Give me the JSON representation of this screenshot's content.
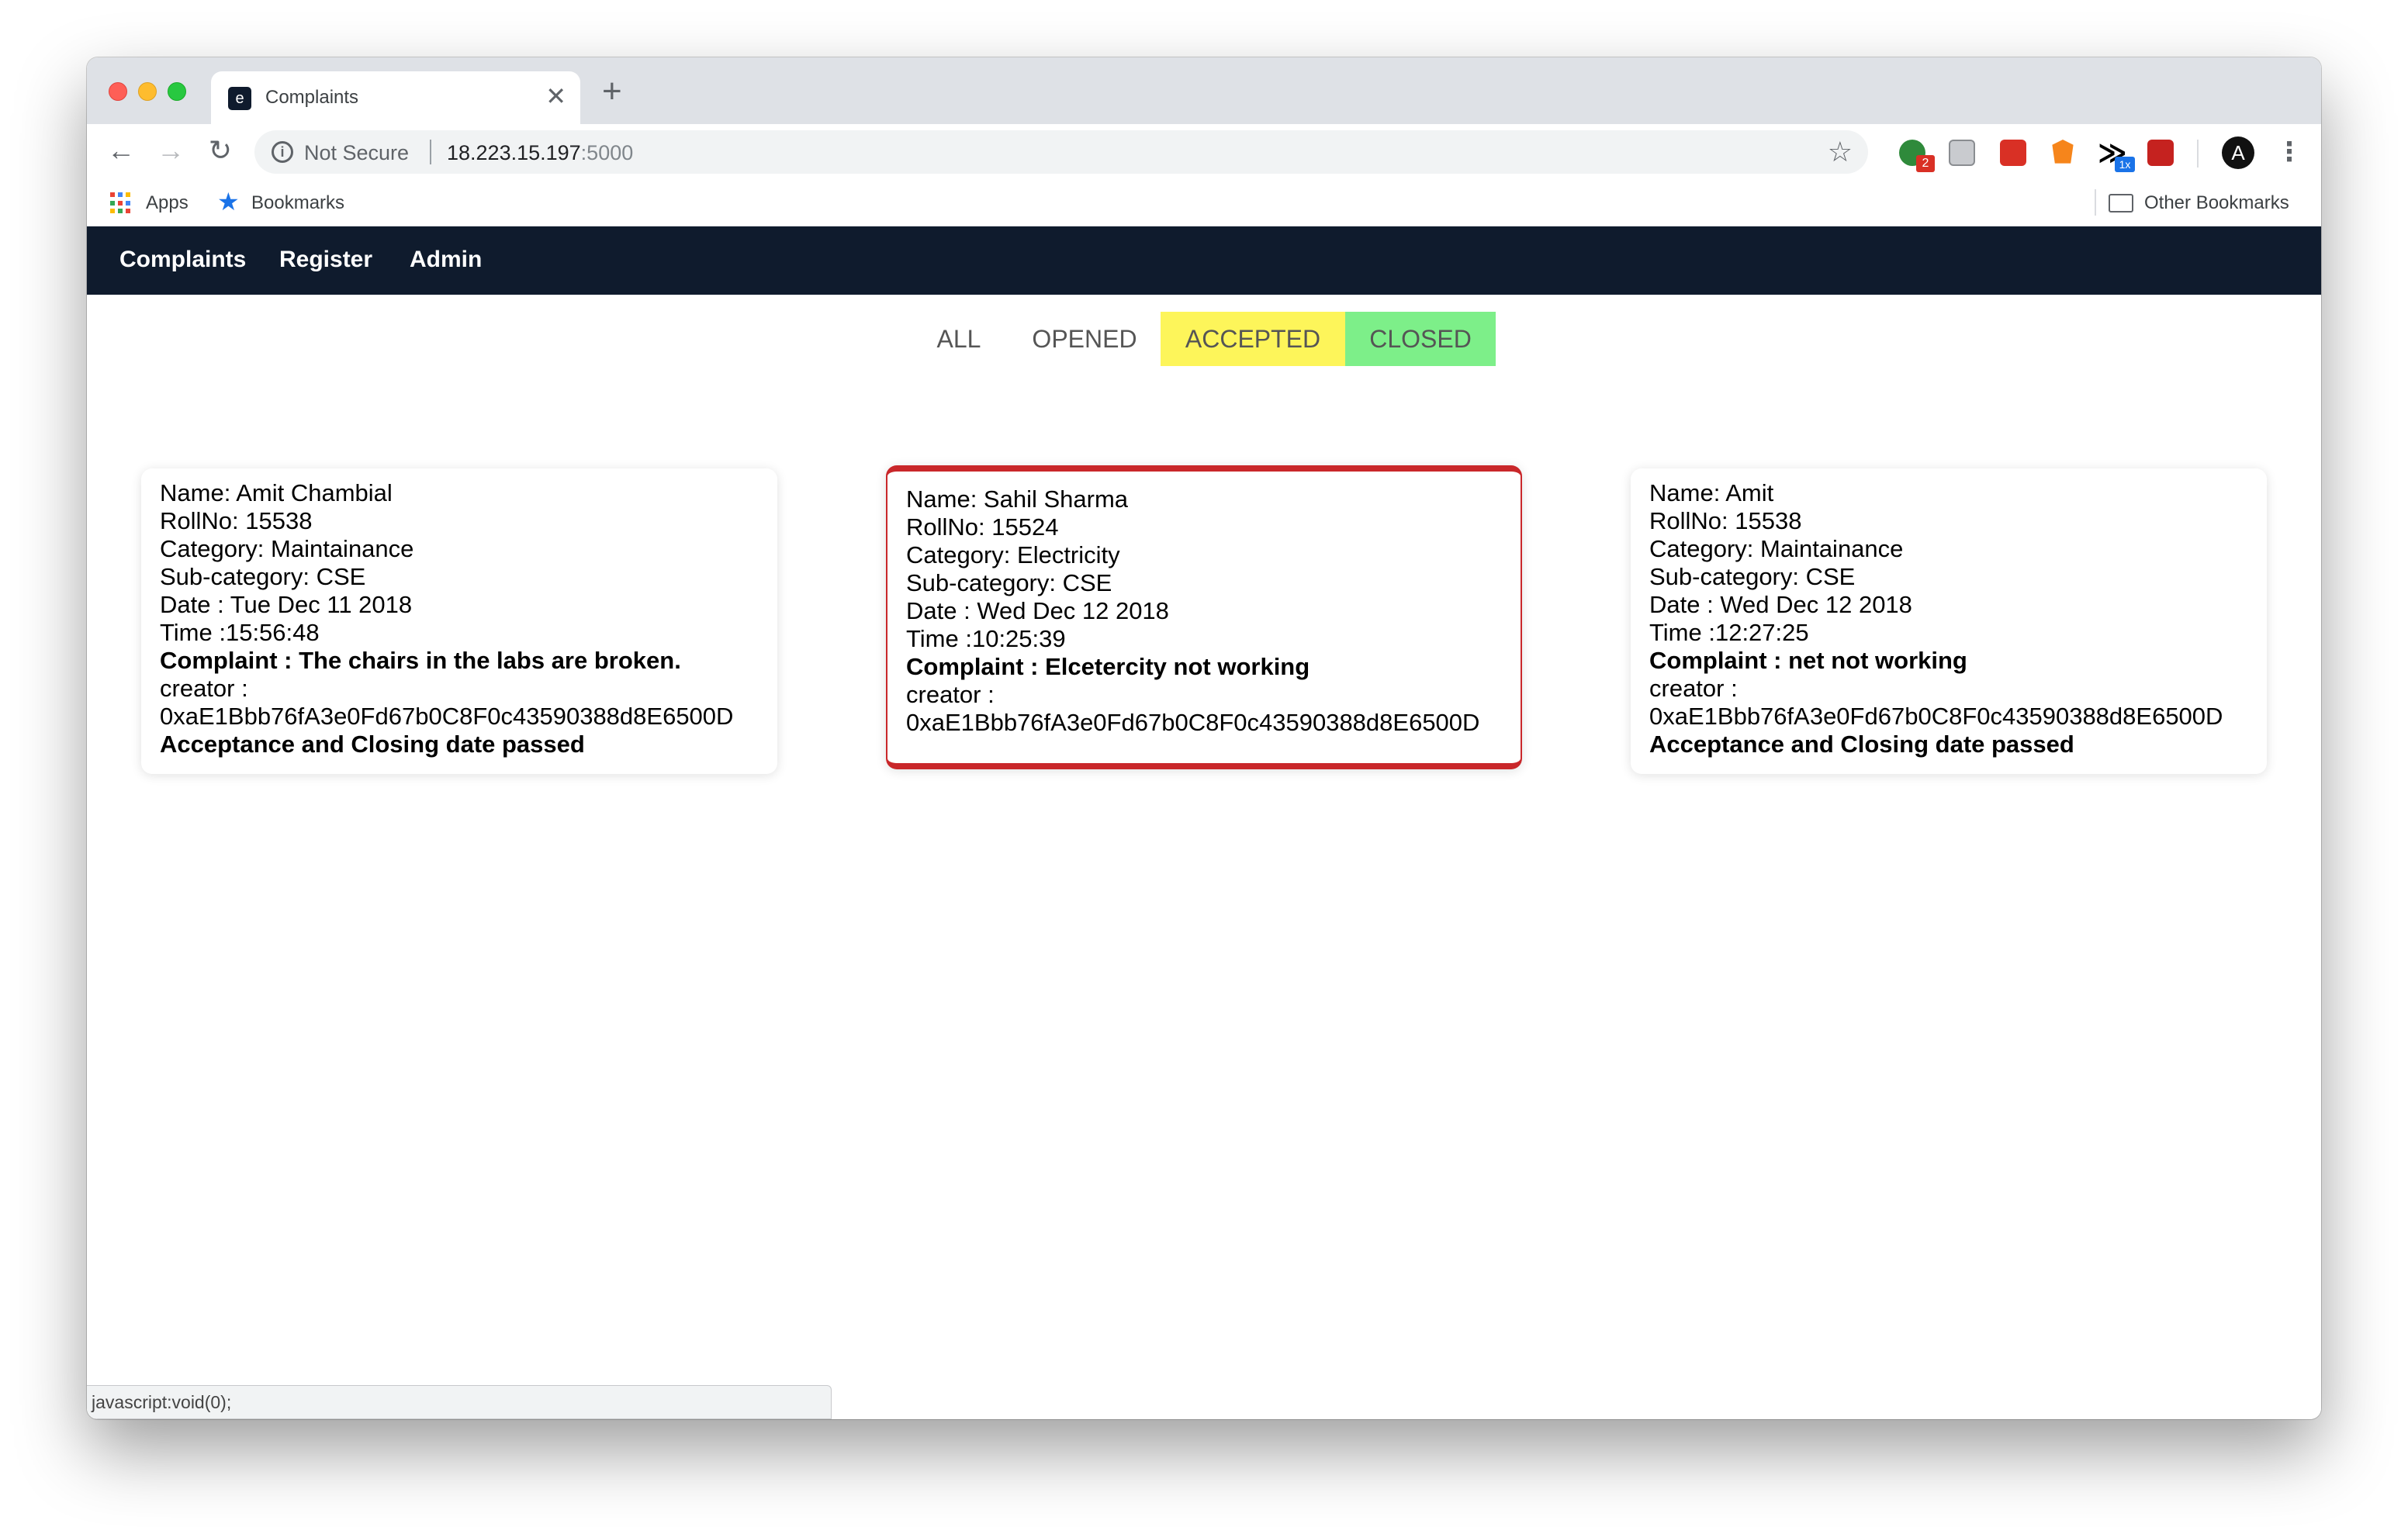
{
  "browser": {
    "tab_title": "Complaints",
    "tab_favicon": "e",
    "new_tab": "+",
    "tab_close": "✕",
    "back": "←",
    "forward": "→",
    "reload": "↻",
    "security_label": "Not Secure",
    "url_host": "18.223.15.197",
    "url_port": ":5000",
    "star": "☆",
    "ext_badge_1": "2",
    "ext_badge_5": "1x",
    "ext_5_glyph": "≫",
    "menu": "⋮",
    "avatar": "A"
  },
  "bookmarks": {
    "apps": "Apps",
    "bookmarks": "Bookmarks",
    "star": "★",
    "other": "Other Bookmarks"
  },
  "nav": {
    "items": [
      "Complaints",
      "Register",
      "Admin"
    ]
  },
  "filters": {
    "items": [
      "ALL",
      "OPENED",
      "ACCEPTED",
      "CLOSED"
    ],
    "colors": {
      "accepted_bg": "#fdf55a",
      "closed_bg": "#7def89"
    }
  },
  "colors": {
    "navbar": "#0f1b2d",
    "card2_border": "#c9272a"
  },
  "complaints": [
    {
      "name": "Name: Amit Chambial",
      "rollno": "RollNo: 15538",
      "category": "Category: Maintainance",
      "subcategory": "Sub-category: CSE",
      "date": "Date : Tue Dec 11 2018",
      "time": "Time :15:56:48",
      "complaint": "Complaint : The chairs in the labs are broken.",
      "creator_label": "creator :",
      "creator": "0xaE1Bbb76fA3e0Fd67b0C8F0c43590388d8E6500D",
      "status": "Acceptance and Closing date passed"
    },
    {
      "name": "Name: Sahil Sharma",
      "rollno": "RollNo: 15524",
      "category": "Category: Electricity",
      "subcategory": "Sub-category: CSE",
      "date": "Date : Wed Dec 12 2018",
      "time": "Time :10:25:39",
      "complaint": "Complaint : Elcetercity not working",
      "creator_label": "creator :",
      "creator": "0xaE1Bbb76fA3e0Fd67b0C8F0c43590388d8E6500D"
    },
    {
      "name": "Name: Amit",
      "rollno": "RollNo: 15538",
      "category": "Category: Maintainance",
      "subcategory": "Sub-category: CSE",
      "date": "Date : Wed Dec 12 2018",
      "time": "Time :12:27:25",
      "complaint": "Complaint : net not working",
      "creator_label": "creator :",
      "creator": "0xaE1Bbb76fA3e0Fd67b0C8F0c43590388d8E6500D",
      "status": "Acceptance and Closing date passed"
    }
  ],
  "status_bar": "javascript:void(0);"
}
